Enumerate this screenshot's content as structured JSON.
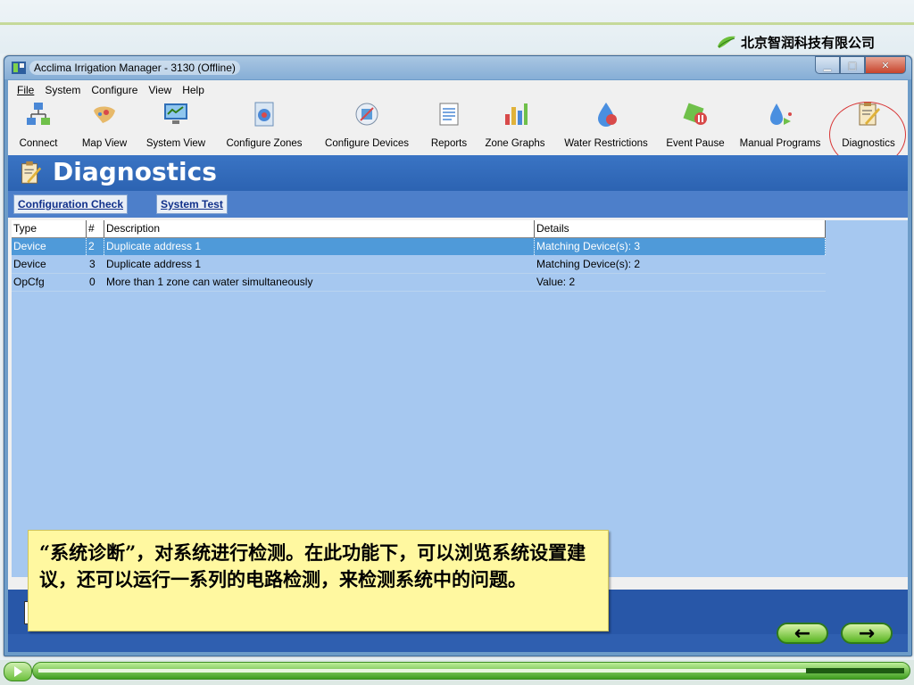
{
  "slide": {
    "company": "北京智润科技有限公司",
    "callout": "“系统诊断”，对系统进行检测。在此功能下，可以浏览系统设置建议，还可以运行一系列的电路检测，来检测系统中的问题。"
  },
  "window": {
    "title": "Acclima Irrigation Manager - 3130 (Offline)"
  },
  "menu": [
    {
      "label": "File",
      "key": "F"
    },
    {
      "label": "System",
      "key": "S"
    },
    {
      "label": "Configure",
      "key": "C"
    },
    {
      "label": "View",
      "key": "V"
    },
    {
      "label": "Help",
      "key": "H"
    }
  ],
  "toolbar": [
    {
      "label": "Connect",
      "icon": "connect-icon"
    },
    {
      "label": "Map View",
      "icon": "map-icon"
    },
    {
      "label": "System View",
      "icon": "system-view-icon"
    },
    {
      "label": "Configure Zones",
      "icon": "zones-icon"
    },
    {
      "label": "Configure Devices",
      "icon": "devices-icon"
    },
    {
      "label": "Reports",
      "icon": "reports-icon"
    },
    {
      "label": "Zone Graphs",
      "icon": "graphs-icon"
    },
    {
      "label": "Water Restrictions",
      "icon": "water-restrictions-icon"
    },
    {
      "label": "Event Pause",
      "icon": "event-pause-icon"
    },
    {
      "label": "Manual Programs",
      "icon": "manual-programs-icon"
    },
    {
      "label": "Diagnostics",
      "icon": "diagnostics-icon"
    }
  ],
  "page": {
    "title": "Diagnostics",
    "tabs": [
      "Configuration Check",
      "System Test"
    ]
  },
  "table": {
    "headers": [
      "Type",
      "#",
      "Description",
      "Details"
    ],
    "rows": [
      [
        "Device",
        "2",
        "Duplicate address 1",
        "Matching Device(s): 3"
      ],
      [
        "Device",
        "3",
        "Duplicate address 1",
        "Matching Device(s): 2"
      ],
      [
        "OpCfg",
        "0",
        "More than 1 zone can water simultaneously",
        "Value: 2"
      ]
    ],
    "selected_row": 0
  },
  "nav": {
    "prev": "←",
    "next": "→"
  },
  "colors": {
    "header": "#2c63b2",
    "selected_row": "#4f9ad9",
    "grid_bg": "#a6c8f0",
    "callout_bg": "#fff8a0"
  }
}
